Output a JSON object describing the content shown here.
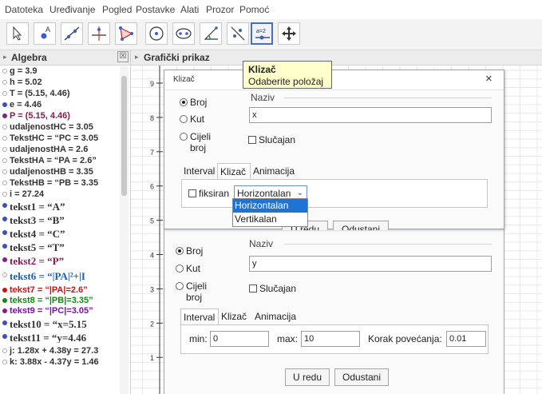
{
  "menu": [
    "Datoteka",
    "Uređivanje",
    "Pogled",
    "Postavke",
    "Alati",
    "Prozor",
    "Pomoć"
  ],
  "tooltip": {
    "title": "Klizač",
    "text": "Odaberite položaj"
  },
  "toolbar": {
    "slider_tool_label": "a=2"
  },
  "algebra": {
    "title": "Algebra",
    "close": "☒",
    "items": [
      {
        "text": "g = 3.9",
        "color": "#333333",
        "dot": "hollow"
      },
      {
        "text": "h = 5.02",
        "color": "#333333",
        "dot": "hollow"
      },
      {
        "text": "T = (5.15, 4.46)",
        "color": "#333333",
        "dot": "hollow"
      },
      {
        "text": "e = 4.46",
        "color": "#333333",
        "dot": "filled-blue"
      },
      {
        "text": "P = (5.15, 4.46)",
        "color": "#8b1a4a",
        "dot": "filled-purple"
      },
      {
        "text": "udaljenostHC = 3.05",
        "color": "#333333",
        "dot": "hollow"
      },
      {
        "text": "TekstHC = “PC = 3.05",
        "color": "#333333",
        "dot": "hollow"
      },
      {
        "text": "udaljenostHA = 2.6",
        "color": "#333333",
        "dot": "hollow"
      },
      {
        "text": "TekstHA = “PA = 2.6”",
        "color": "#333333",
        "dot": "hollow"
      },
      {
        "text": "udaljenostHB = 3.35",
        "color": "#333333",
        "dot": "hollow"
      },
      {
        "text": "TekstHB = “PB = 3.35",
        "color": "#333333",
        "dot": "hollow"
      },
      {
        "text": "i = 27.24",
        "color": "#333333",
        "dot": "hollow"
      },
      {
        "text": "tekst1 = “A”",
        "color": "#333333",
        "dot": "filled-blue",
        "serif": true
      },
      {
        "text": "tekst3 = “B”",
        "color": "#333333",
        "dot": "filled-blue",
        "serif": true
      },
      {
        "text": "tekst4 = “C”",
        "color": "#333333",
        "dot": "filled-blue",
        "serif": true
      },
      {
        "text": "tekst5 = “T”",
        "color": "#333333",
        "dot": "filled-blue",
        "serif": true
      },
      {
        "text": "tekst2 = “P”",
        "color": "#8b1a4a",
        "dot": "filled-purple",
        "serif": true
      },
      {
        "text": "tekst6 = “|PA|²+|I",
        "color": "#1a5fb4",
        "dot": "hollow",
        "serif": true
      },
      {
        "text": "tekst7 = “|PA|=2.6”",
        "color": "#cc1111",
        "dot": "filled-red"
      },
      {
        "text": "tekst8 = “|PB|=3.35”",
        "color": "#118811",
        "dot": "filled-green"
      },
      {
        "text": "tekst9 = “|PC|=3.05”",
        "color": "#7711aa",
        "dot": "filled-purple"
      },
      {
        "text": "tekst10 = “x=5.15",
        "color": "#333333",
        "dot": "filled-blue",
        "serif": true
      },
      {
        "text": "tekst11 = “y=4.46",
        "color": "#333333",
        "dot": "filled-blue",
        "serif": true
      },
      {
        "text": "j: 1.28x + 4.38y = 27.3",
        "color": "#333333",
        "dot": "hollow"
      },
      {
        "text": "k: 3.88x - 4.37y = 1.46",
        "color": "#333333",
        "dot": "hollow"
      }
    ]
  },
  "graphics": {
    "title": "Grafički prikaz",
    "y_ticks": [
      "9",
      "8",
      "7",
      "6",
      "5",
      "4",
      "3",
      "2",
      "1"
    ]
  },
  "dialog": {
    "title": "Klizač",
    "close": "×",
    "radio_number": "Broj",
    "radio_angle": "Kut",
    "radio_integer": "Cijeli broj",
    "name_label": "Naziv",
    "name_value": "x",
    "random_label": "Slučajan",
    "tabs": [
      "Interval",
      "Klizač",
      "Animacija"
    ],
    "fixed_label": "fiksiran",
    "orientation_value": "Horizontalan",
    "orientation_options": [
      "Horizontalan",
      "Vertikalan"
    ],
    "ok": "U redu",
    "cancel": "Odustani"
  },
  "dialog2": {
    "radio_number": "Broj",
    "radio_angle": "Kut",
    "radio_integer": "Cijeli broj",
    "name_label": "Naziv",
    "name_value": "y",
    "random_label": "Slučajan",
    "tabs": [
      "Interval",
      "Klizač",
      "Animacija"
    ],
    "min_label": "min:",
    "min_value": "0",
    "max_label": "max:",
    "max_value": "10",
    "step_label": "Korak povećanja:",
    "step_value": "0.01",
    "ok": "U redu",
    "cancel": "Odustani"
  }
}
